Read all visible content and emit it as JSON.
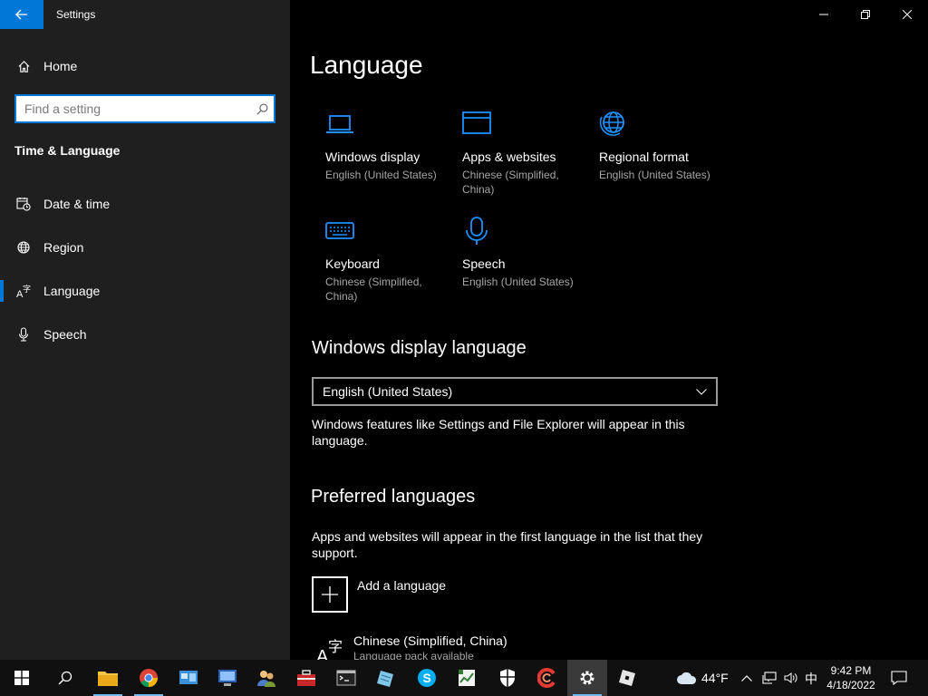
{
  "window": {
    "app_title": "Settings"
  },
  "nav": {
    "home_label": "Home",
    "search_placeholder": "Find a setting",
    "category_title": "Time & Language",
    "items": [
      {
        "label": "Date & time",
        "icon": "calendar-clock-icon"
      },
      {
        "label": "Region",
        "icon": "globe-icon"
      },
      {
        "label": "Language",
        "icon": "language-icon",
        "selected": true
      },
      {
        "label": "Speech",
        "icon": "microphone-icon"
      }
    ]
  },
  "main": {
    "page_title": "Language",
    "tiles": [
      {
        "name": "Windows display",
        "value": "English (United States)",
        "icon": "laptop-icon"
      },
      {
        "name": "Apps & websites",
        "value": "Chinese (Simplified, China)",
        "icon": "browser-window-icon"
      },
      {
        "name": "Regional format",
        "value": "English (United States)",
        "icon": "globe-icon"
      },
      {
        "name": "Keyboard",
        "value": "Chinese (Simplified, China)",
        "icon": "keyboard-icon"
      },
      {
        "name": "Speech",
        "value": "English (United States)",
        "icon": "microphone-icon"
      }
    ],
    "display_language": {
      "heading": "Windows display language",
      "selected": "English (United States)",
      "description": "Windows features like Settings and File Explorer will appear in this language."
    },
    "preferred": {
      "heading": "Preferred languages",
      "description": "Apps and websites will appear in the first language in the list that they support.",
      "add_label": "Add a language",
      "languages": [
        {
          "name": "Chinese (Simplified, China)",
          "status": "Language pack available"
        }
      ]
    }
  },
  "taskbar": {
    "weather_temp": "44°F",
    "ime_indicator": "中",
    "time": "9:42 PM",
    "date": "4/18/2022"
  },
  "colors": {
    "accent": "#0078d7",
    "nav_bg": "#1f1f1f",
    "main_bg": "#000000",
    "secondary_text": "#a6a6a6"
  }
}
